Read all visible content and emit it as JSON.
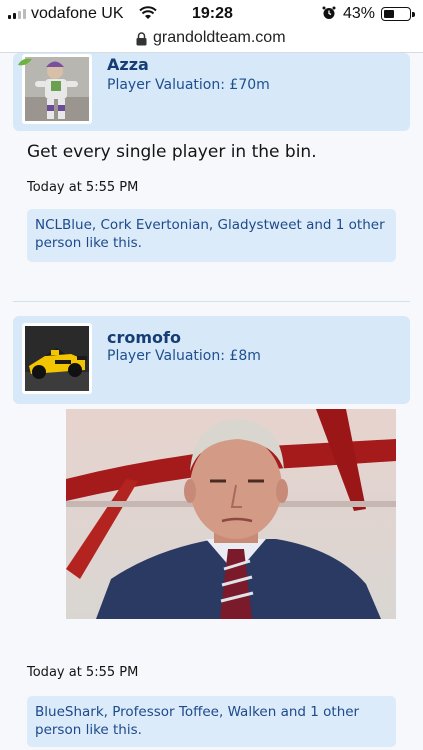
{
  "status_bar": {
    "carrier": "vodafone UK",
    "time": "19:28",
    "battery_percent": "43%",
    "battery_level": 0.43
  },
  "browser": {
    "url": "grandoldteam.com"
  },
  "posts": [
    {
      "username": "Azza",
      "valuation": "Player Valuation: £70m",
      "avatar": "toy-spaceman-avatar-icon",
      "message": "Get every single player in the bin.",
      "timestamp": "Today at 5:55 PM",
      "likes": "NCLBlue, Cork Evertonian, Gladystweet and 1 other person like this."
    },
    {
      "username": "cromofo",
      "valuation": "Player Valuation: £8m",
      "avatar": "yellow-race-car-avatar-icon",
      "image": "manager-photo",
      "timestamp": "Today at 5:55 PM",
      "likes": "BlueShark, Professor Toffee, Walken and 1 other person like this."
    }
  ],
  "colors": {
    "header_bg": "#d7e9f9",
    "username": "#163d74",
    "likes_bg": "#dcebfa",
    "likes_text": "#1d4a8a"
  }
}
